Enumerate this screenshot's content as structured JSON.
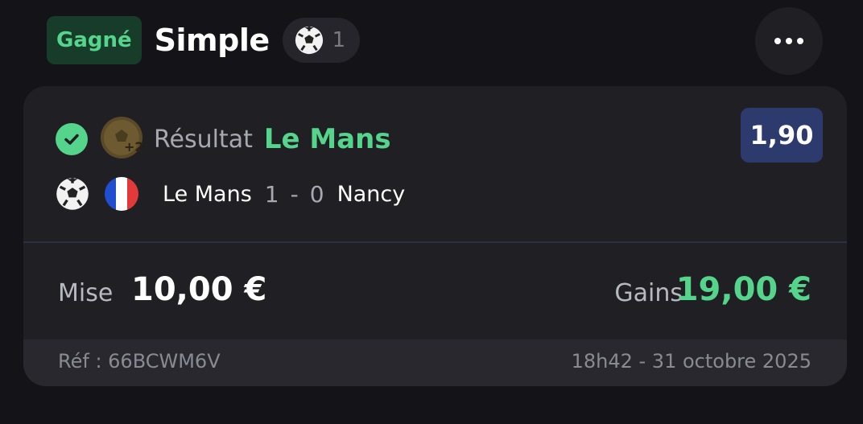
{
  "header": {
    "status": "Gagné",
    "bet_type": "Simple",
    "sport_icon": "soccer-ball-icon",
    "sport_count": "1",
    "more_icon": "more-horizontal-icon"
  },
  "selection": {
    "status_icon": "check-circle-icon",
    "boost_icon": "boost-ball-icon",
    "market": "Résultat",
    "pick": "Le Mans",
    "odds": "1,90",
    "sport_icon": "soccer-ball-icon",
    "country_icon": "france-flag-icon",
    "home_team": "Le Mans",
    "home_score": "1",
    "separator": "-",
    "away_score": "0",
    "away_team": "Nancy"
  },
  "summary": {
    "stake_label": "Mise",
    "stake_value": "10,00 €",
    "gains_label": "Gains",
    "gains_value": "19,00 €"
  },
  "footer": {
    "reference": "Réf : 66BCWM6V",
    "datetime": "18h42 - 31 octobre 2025"
  },
  "colors": {
    "background": "#141418",
    "card": "#1f1f24",
    "accent_green": "#55d48c",
    "odds_badge": "#2c3a6e"
  }
}
